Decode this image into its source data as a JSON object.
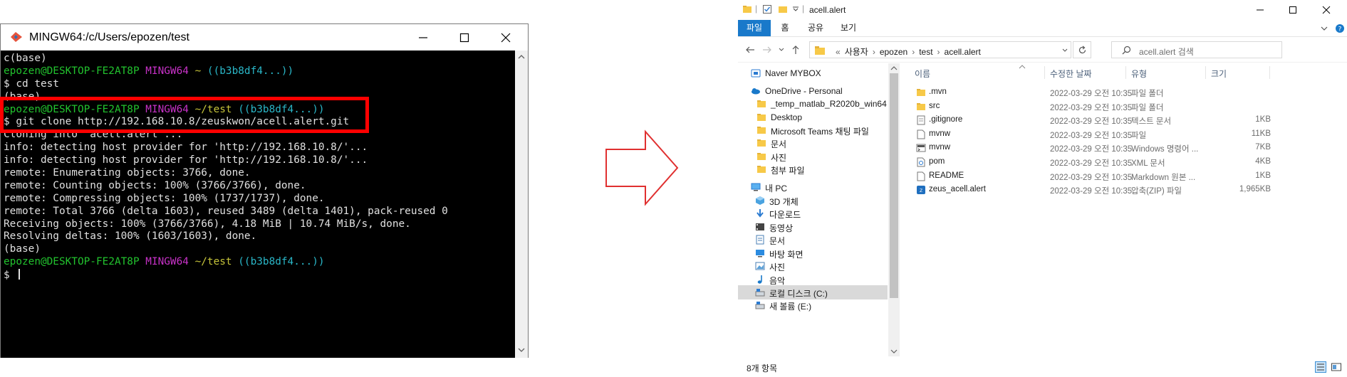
{
  "terminal": {
    "title": "MINGW64:/c/Users/epozen/test",
    "lines": [
      [
        {
          "t": "c(base)",
          "c": "white"
        }
      ],
      [
        {
          "t": "epozen@DESKTOP-FE2AT8P ",
          "c": "green"
        },
        {
          "t": "MINGW64 ",
          "c": "magenta"
        },
        {
          "t": "~ ",
          "c": "yellow"
        },
        {
          "t": "((b3b8df4...))",
          "c": "cyan"
        }
      ],
      [
        {
          "t": "$ cd test",
          "c": "white"
        }
      ],
      [
        {
          "t": "(base)",
          "c": "white"
        }
      ],
      [
        {
          "t": "epozen@DESKTOP-FE2AT8P ",
          "c": "green"
        },
        {
          "t": "MINGW64 ",
          "c": "magenta"
        },
        {
          "t": "~/test ",
          "c": "yellow"
        },
        {
          "t": "((b3b8df4...))",
          "c": "cyan"
        }
      ],
      [
        {
          "t": "$ git clone http://192.168.10.8/zeuskwon/acell.alert.git",
          "c": "white"
        }
      ],
      [
        {
          "t": "Cloning into 'acell.alert'...",
          "c": "white"
        }
      ],
      [
        {
          "t": "info: detecting host provider for 'http://192.168.10.8/'...",
          "c": "white"
        }
      ],
      [
        {
          "t": "info: detecting host provider for 'http://192.168.10.8/'...",
          "c": "white"
        }
      ],
      [
        {
          "t": "remote: Enumerating objects: 3766, done.",
          "c": "white"
        }
      ],
      [
        {
          "t": "remote: Counting objects: 100% (3766/3766), done.",
          "c": "white"
        }
      ],
      [
        {
          "t": "remote: Compressing objects: 100% (1737/1737), done.",
          "c": "white"
        }
      ],
      [
        {
          "t": "remote: Total 3766 (delta 1603), reused 3489 (delta 1401), pack-reused 0",
          "c": "white"
        }
      ],
      [
        {
          "t": "Receiving objects: 100% (3766/3766), 4.18 MiB | 10.74 MiB/s, done.",
          "c": "white"
        }
      ],
      [
        {
          "t": "Resolving deltas: 100% (1603/1603), done.",
          "c": "white"
        }
      ],
      [
        {
          "t": "(base)",
          "c": "white"
        }
      ],
      [
        {
          "t": "epozen@DESKTOP-FE2AT8P ",
          "c": "green"
        },
        {
          "t": "MINGW64 ",
          "c": "magenta"
        },
        {
          "t": "~/test ",
          "c": "yellow"
        },
        {
          "t": "((b3b8df4...))",
          "c": "cyan"
        }
      ],
      [
        {
          "t": "$ ",
          "c": "white"
        }
      ]
    ]
  },
  "explorer": {
    "title": "acell.alert",
    "tabs": [
      "파일",
      "홈",
      "공유",
      "보기"
    ],
    "breadcrumb": [
      "«",
      "사용자",
      "›",
      "epozen",
      "›",
      "test",
      "›",
      "acell.alert"
    ],
    "search_placeholder": "acell.alert 검색",
    "nav_items": [
      {
        "label": "Naver MYBOX",
        "icon": "naver-mybox-icon"
      },
      {
        "label": "OneDrive - Personal",
        "icon": "onedrive-cloud-icon"
      },
      {
        "label": "_temp_matlab_R2020b_win64",
        "icon": "folder-icon"
      },
      {
        "label": "Desktop",
        "icon": "folder-icon"
      },
      {
        "label": "Microsoft Teams 채팅 파일",
        "icon": "folder-icon"
      },
      {
        "label": "문서",
        "icon": "folder-icon"
      },
      {
        "label": "사진",
        "icon": "folder-icon"
      },
      {
        "label": "첨부 파일",
        "icon": "folder-icon"
      },
      {
        "label": "내 PC",
        "icon": "pc-icon"
      },
      {
        "label": "3D 개체",
        "icon": "3d-objects-icon"
      },
      {
        "label": "다운로드",
        "icon": "download-icon"
      },
      {
        "label": "동영상",
        "icon": "video-icon"
      },
      {
        "label": "문서",
        "icon": "document-icon"
      },
      {
        "label": "바탕 화면",
        "icon": "desktop-icon"
      },
      {
        "label": "사진",
        "icon": "pictures-icon"
      },
      {
        "label": "음악",
        "icon": "music-icon"
      },
      {
        "label": "로컬 디스크 (C:)",
        "icon": "drive-icon"
      },
      {
        "label": "새 볼륨 (E:)",
        "icon": "drive-icon"
      }
    ],
    "columns": {
      "name": "이름",
      "date": "수정한 날짜",
      "type": "유형",
      "size": "크기"
    },
    "files": [
      {
        "name": ".mvn",
        "date": "2022-03-29 오전 10:35",
        "type": "파일 폴더",
        "size": "",
        "icon": "folder-icon"
      },
      {
        "name": "src",
        "date": "2022-03-29 오전 10:35",
        "type": "파일 폴더",
        "size": "",
        "icon": "folder-icon"
      },
      {
        "name": ".gitignore",
        "date": "2022-03-29 오전 10:35",
        "type": "텍스트 문서",
        "size": "1KB",
        "icon": "text-file-icon"
      },
      {
        "name": "mvnw",
        "date": "2022-03-29 오전 10:35",
        "type": "파일",
        "size": "11KB",
        "icon": "file-icon"
      },
      {
        "name": "mvnw",
        "date": "2022-03-29 오전 10:35",
        "type": "Windows 명령어 ...",
        "size": "7KB",
        "icon": "cmd-file-icon"
      },
      {
        "name": "pom",
        "date": "2022-03-29 오전 10:35",
        "type": "XML 문서",
        "size": "4KB",
        "icon": "xml-file-icon"
      },
      {
        "name": "README",
        "date": "2022-03-29 오전 10:35",
        "type": "Markdown 원본 ...",
        "size": "1KB",
        "icon": "file-icon"
      },
      {
        "name": "zeus_acell.alert",
        "date": "2022-03-29 오전 10:35",
        "type": "압축(ZIP) 파일",
        "size": "1,965KB",
        "icon": "zip-file-icon"
      }
    ],
    "status": "8개 항목",
    "colors": {
      "accent": "#1979ca",
      "folder": "#f7c948"
    }
  }
}
